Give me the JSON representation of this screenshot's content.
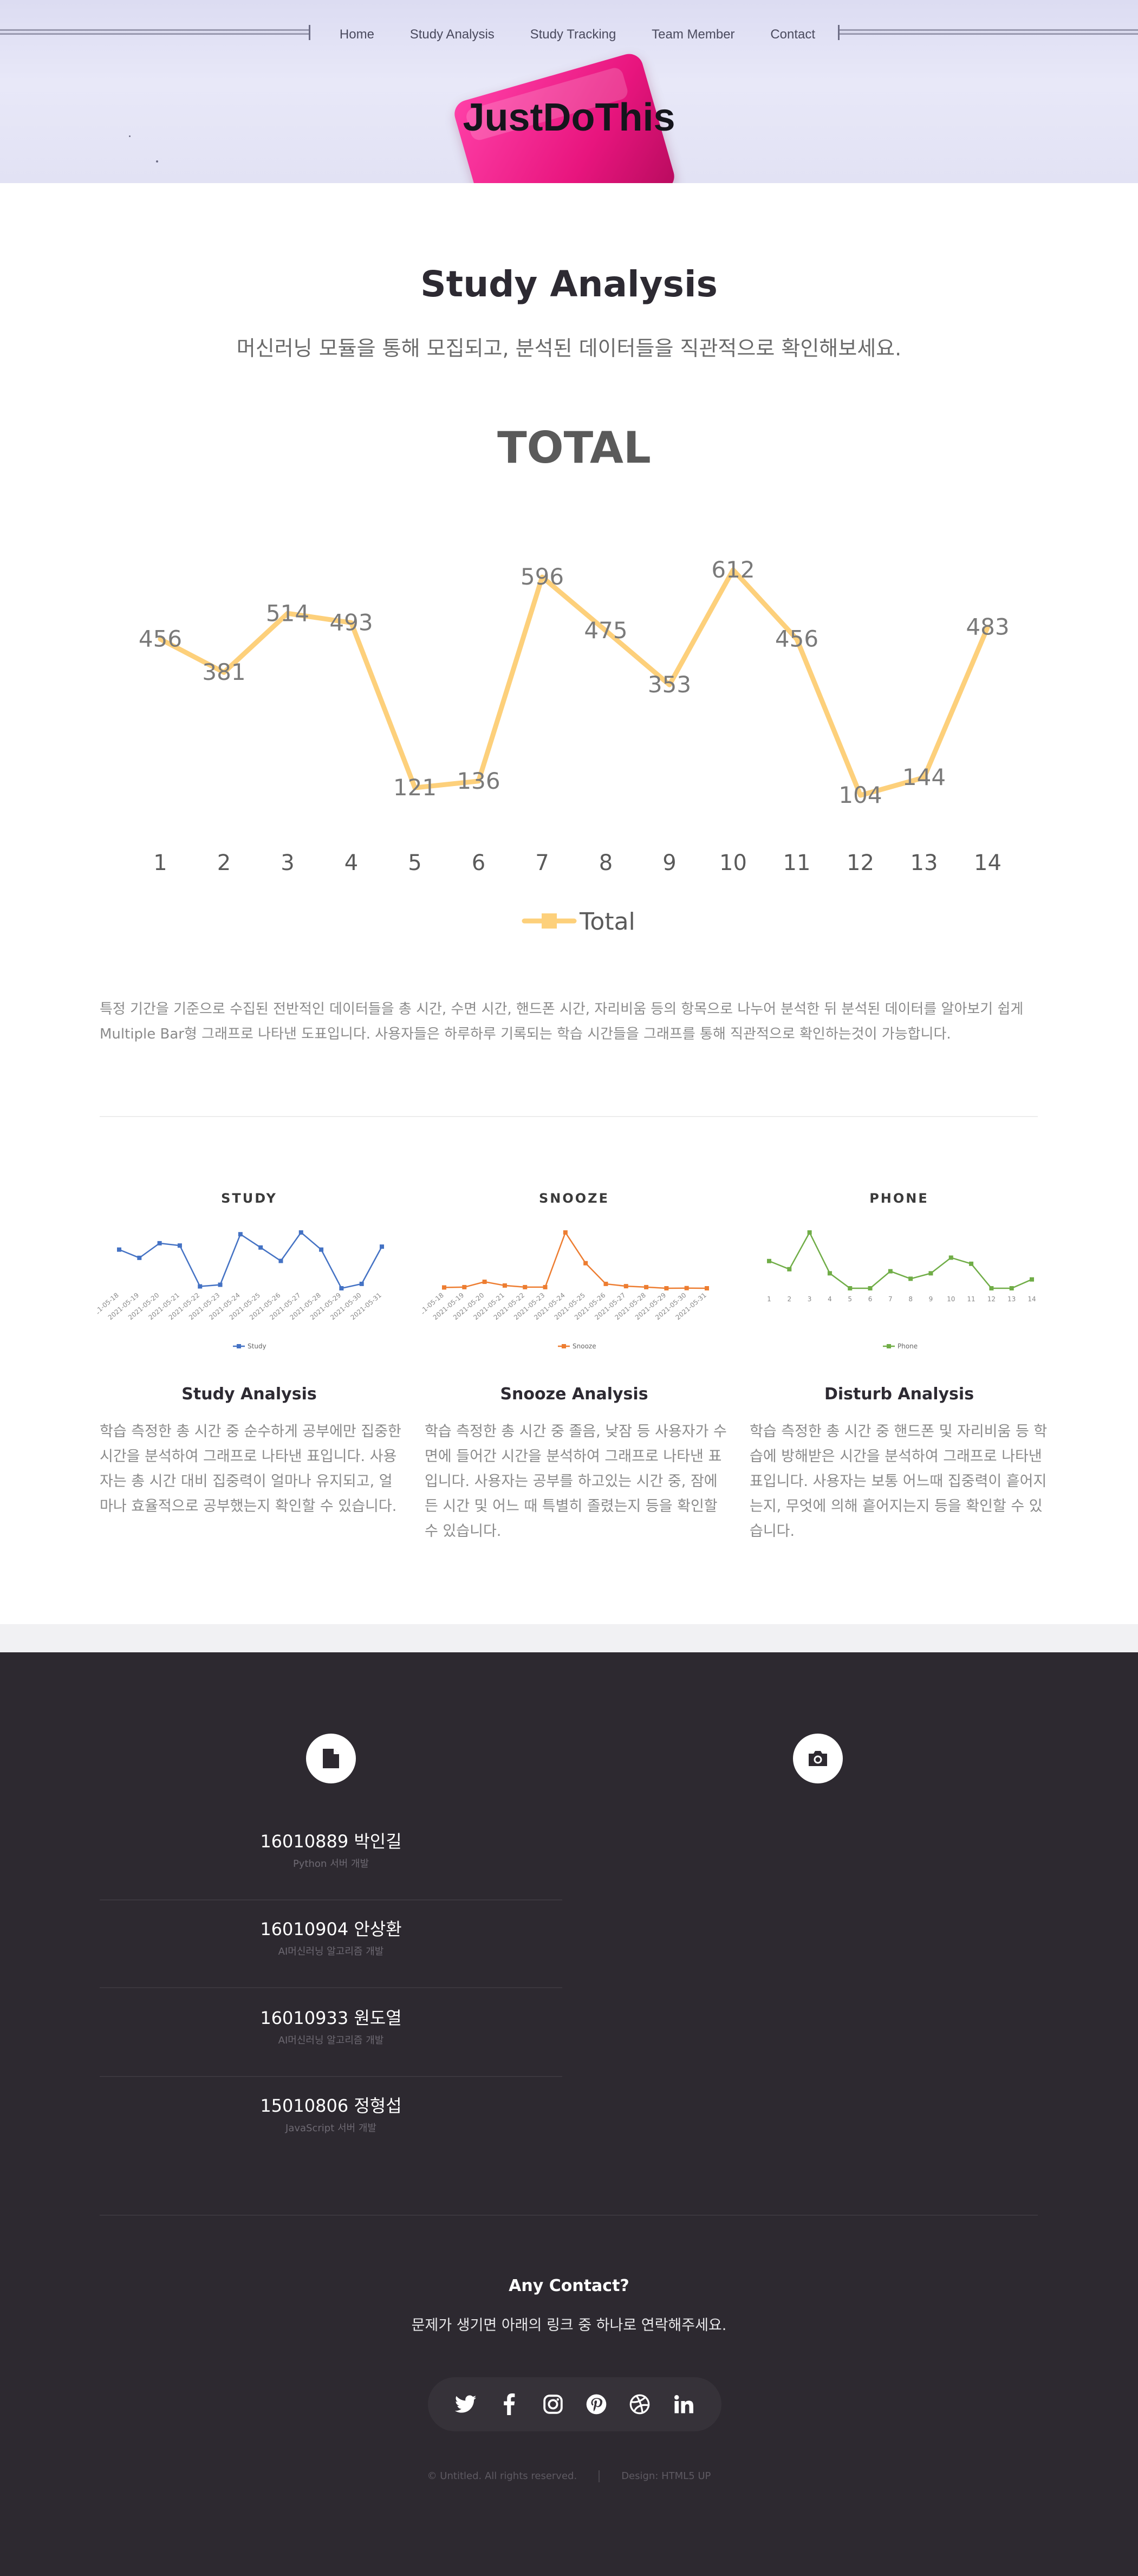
{
  "nav": {
    "items": [
      "Home",
      "Study Analysis",
      "Study Tracking",
      "Team Member",
      "Contact"
    ]
  },
  "hero": {
    "title": "JustDoThis"
  },
  "section": {
    "title": "Study Analysis",
    "subtitle": "머신러닝 모듈을 통해 모집되고, 분석된 데이터들을 직관적으로 확인해보세요."
  },
  "chart_data": [
    {
      "type": "line",
      "title": "TOTAL",
      "categories": [
        "1",
        "2",
        "3",
        "4",
        "5",
        "6",
        "7",
        "8",
        "9",
        "10",
        "11",
        "12",
        "13",
        "14"
      ],
      "series": [
        {
          "name": "Total",
          "values": [
            456,
            381,
            514,
            493,
            121,
            136,
            596,
            475,
            353,
            612,
            456,
            104,
            144,
            483
          ]
        }
      ],
      "color": "#fdd07b",
      "legend": "bottom",
      "grid": false
    },
    {
      "type": "line",
      "title": "STUDY",
      "categories": [
        "2021-05-18",
        "2021-05-19",
        "2021-05-20",
        "2021-05-21",
        "2021-05-22",
        "2021-05-23",
        "2021-05-24",
        "2021-05-25",
        "2021-05-26",
        "2021-05-27",
        "2021-05-28",
        "2021-05-29",
        "2021-05-30",
        "2021-05-31"
      ],
      "series": [
        {
          "name": "Study",
          "values": [
            456,
            381,
            514,
            493,
            121,
            136,
            596,
            475,
            353,
            612,
            456,
            104,
            144,
            483
          ]
        }
      ],
      "color": "#4472c4",
      "legend": "bottom"
    },
    {
      "type": "line",
      "title": "SNOOZE",
      "categories": [
        "2021-05-18",
        "2021-05-19",
        "2021-05-20",
        "2021-05-21",
        "2021-05-22",
        "2021-05-23",
        "2021-05-24",
        "2021-05-25",
        "2021-05-26",
        "2021-05-27",
        "2021-05-28",
        "2021-05-29",
        "2021-05-30",
        "2021-05-31"
      ],
      "series": [
        {
          "name": "Snooze",
          "values": [
            60,
            62,
            95,
            72,
            62,
            62,
            400,
            210,
            82,
            68,
            62,
            55,
            56,
            55
          ]
        }
      ],
      "color": "#ed7d31",
      "legend": "bottom"
    },
    {
      "type": "line",
      "title": "PHONE",
      "categories": [
        "1",
        "2",
        "3",
        "4",
        "5",
        "6",
        "7",
        "8",
        "9",
        "10",
        "11",
        "12",
        "13",
        "14"
      ],
      "series": [
        {
          "name": "Phone",
          "values": [
            70,
            58,
            112,
            52,
            30,
            30,
            55,
            44,
            52,
            75,
            66,
            30,
            30,
            43
          ]
        }
      ],
      "color": "#70ad47",
      "legend": "bottom"
    }
  ],
  "description": "특정 기간을 기준으로 수집된 전반적인 데이터들을 총 시간, 수면 시간, 핸드폰 시간, 자리비움 등의 항목으로 나누어 분석한 뒤 분석된 데이터를 알아보기 쉽게 Multiple Bar형 그래프로 나타낸 도표입니다. 사용자들은 하루하루 기록되는 학습 시간들을 그래프를 통해 직관적으로 확인하는것이 가능합니다.",
  "cards": [
    {
      "title": "Study Analysis",
      "text": "학습 측정한 총 시간 중 순수하게 공부에만 집중한 시간을 분석하여 그래프로 나타낸 표입니다. 사용자는 총 시간 대비 집중력이 얼마나 유지되고, 얼마나 효율적으로 공부했는지 확인할 수 있습니다."
    },
    {
      "title": "Snooze Analysis",
      "text": "학습 측정한 총 시간 중 졸음, 낮잠 등 사용자가 수면에 들어간 시간을 분석하여 그래프로 나타낸 표입니다. 사용자는 공부를 하고있는 시간 중, 잠에 든 시간 및 어느 때 특별히 졸렸는지 등을 확인할 수 있습니다."
    },
    {
      "title": "Disturb Analysis",
      "text": "학습 측정한 총 시간 중 핸드폰 및 자리비움 등 학습에 방해받은 시간을 분석하여 그래프로 나타낸 표입니다. 사용자는 보통 어느때 집중력이 흩어지는지, 무엇에 의해 흩어지는지 등을 확인할 수 있습니다."
    }
  ],
  "icons": {
    "doc": "document-icon",
    "camera": "camera-icon"
  },
  "members": [
    {
      "name": "16010889 박인길",
      "role": "Python 서버 개발"
    },
    {
      "name": "16010904 안상환",
      "role": "AI머신러닝 알고리즘 개발"
    },
    {
      "name": "16010933 원도열",
      "role": "AI머신러닝 알고리즘 개발"
    },
    {
      "name": "15010806 정형섭",
      "role": "JavaScript 서버 개발"
    }
  ],
  "contact": {
    "title": "Any Contact?",
    "text": "문제가 생기면 아래의 링크 중 하나로 연락해주세요."
  },
  "social": [
    "twitter-icon",
    "facebook-icon",
    "instagram-icon",
    "pinterest-icon",
    "dribbble-icon",
    "linkedin-icon"
  ],
  "copyright": {
    "left": "© Untitled. All rights reserved.",
    "right": "Design: HTML5 UP"
  }
}
